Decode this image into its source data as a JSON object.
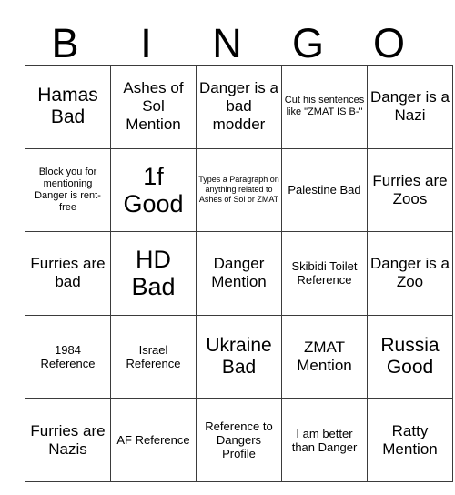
{
  "card": {
    "title": "BINGO",
    "header": [
      {
        "letter": "B"
      },
      {
        "letter": "I"
      },
      {
        "letter": "N"
      },
      {
        "letter": "G"
      },
      {
        "letter": "O"
      }
    ],
    "colors": {
      "background": "#ffffff",
      "text": "#000000",
      "border": "#3b3b3b"
    },
    "grid_size": "5x5",
    "rows": [
      [
        {
          "text": "Hamas Bad",
          "size": "lg"
        },
        {
          "text": "Ashes of Sol Mention",
          "size": "md"
        },
        {
          "text": "Danger is a bad modder",
          "size": "md"
        },
        {
          "text": "Cut his sentences like \"ZMAT IS B-\"",
          "size": "xs"
        },
        {
          "text": "Danger is a Nazi",
          "size": "md"
        }
      ],
      [
        {
          "text": "Block you for mentioning Danger is rent-free",
          "size": "xs"
        },
        {
          "text": "1f Good",
          "size": "xl"
        },
        {
          "text": "Types a Paragraph on anything related to Ashes of Sol or ZMAT",
          "size": "xxs"
        },
        {
          "text": "Palestine Bad",
          "size": "sm"
        },
        {
          "text": "Furries are Zoos",
          "size": "md"
        }
      ],
      [
        {
          "text": "Furries are bad",
          "size": "md"
        },
        {
          "text": "HD Bad",
          "size": "xl"
        },
        {
          "text": "Danger Mention",
          "size": "md"
        },
        {
          "text": "Skibidi Toilet Reference",
          "size": "sm"
        },
        {
          "text": "Danger is a Zoo",
          "size": "md"
        }
      ],
      [
        {
          "text": "1984 Reference",
          "size": "sm"
        },
        {
          "text": "Israel Reference",
          "size": "sm"
        },
        {
          "text": "Ukraine Bad",
          "size": "lg"
        },
        {
          "text": "ZMAT Mention",
          "size": "md"
        },
        {
          "text": "Russia Good",
          "size": "lg"
        }
      ],
      [
        {
          "text": "Furries are Nazis",
          "size": "md"
        },
        {
          "text": "AF Reference",
          "size": "sm"
        },
        {
          "text": "Reference to Dangers Profile",
          "size": "sm"
        },
        {
          "text": "I am better than Danger",
          "size": "sm"
        },
        {
          "text": "Ratty Mention",
          "size": "md"
        }
      ]
    ]
  }
}
